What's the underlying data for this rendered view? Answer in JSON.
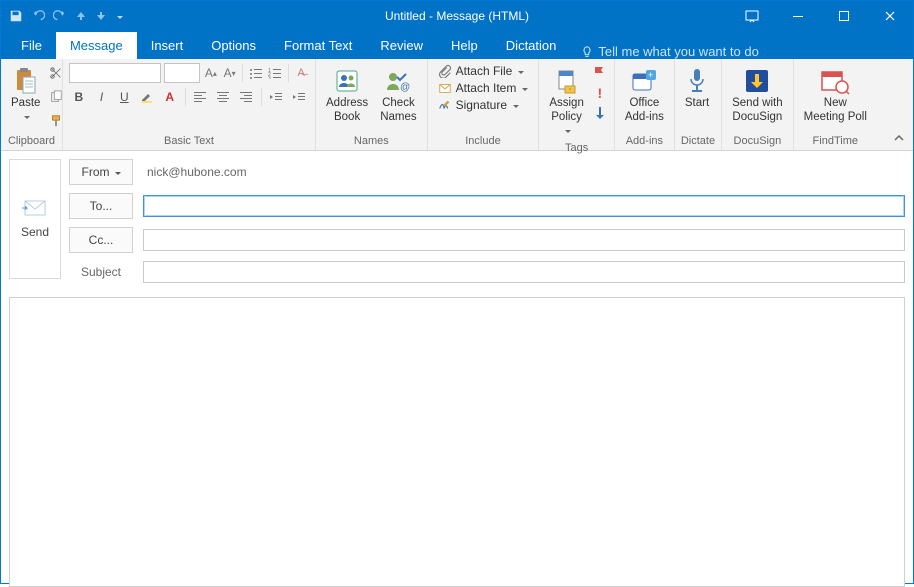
{
  "title": "Untitled  -  Message (HTML)",
  "tabs": {
    "file": "File",
    "message": "Message",
    "insert": "Insert",
    "options": "Options",
    "format_text": "Format Text",
    "review": "Review",
    "help": "Help",
    "dictation": "Dictation"
  },
  "tellme_placeholder": "Tell me what you want to do",
  "ribbon": {
    "clipboard": {
      "paste": "Paste",
      "label": "Clipboard"
    },
    "basic_text": {
      "label": "Basic Text",
      "font": "",
      "size": ""
    },
    "names": {
      "address_book": "Address\nBook",
      "check_names": "Check\nNames",
      "label": "Names"
    },
    "include": {
      "attach_file": "Attach File",
      "attach_item": "Attach Item",
      "signature": "Signature",
      "label": "Include"
    },
    "tags": {
      "assign_policy": "Assign\nPolicy",
      "label": "Tags"
    },
    "addins": {
      "office_addins": "Office\nAdd-ins",
      "label": "Add-ins"
    },
    "dictate": {
      "start": "Start",
      "label": "Dictate"
    },
    "docusign": {
      "send_with": "Send with\nDocuSign",
      "label": "DocuSign"
    },
    "findtime": {
      "new_meeting_poll": "New\nMeeting Poll",
      "label": "FindTime"
    }
  },
  "compose": {
    "send": "Send",
    "from": "From",
    "from_value": "nick@hubone.com",
    "to": "To...",
    "to_value": "",
    "cc": "Cc...",
    "cc_value": "",
    "subject_label": "Subject",
    "subject_value": ""
  }
}
